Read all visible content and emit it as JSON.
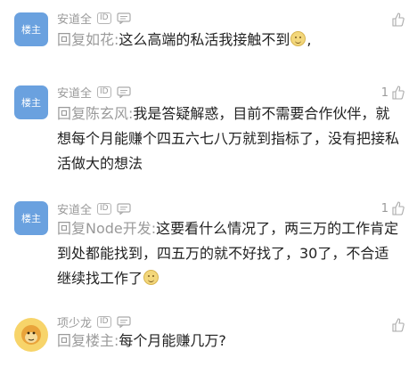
{
  "comments": [
    {
      "avatar_label": "楼主",
      "username": "安道全",
      "id_badge": "ID",
      "likes": "",
      "reply_prefix": "回复如花:",
      "text": "这么高端的私活我接触不到",
      "text_after": ","
    },
    {
      "avatar_label": "楼主",
      "username": "安道全",
      "id_badge": "ID",
      "likes": "1",
      "reply_prefix": "回复陈玄风:",
      "text": "我是答疑解惑，目前不需要合作伙伴，就想每个月能赚个四五六七八万就到指标了，没有把接私活做大的想法",
      "text_after": ""
    },
    {
      "avatar_label": "楼主",
      "username": "安道全",
      "id_badge": "ID",
      "likes": "1",
      "reply_prefix": "回复Node开发:",
      "text": "这要看什么情况了，两三万的工作肯定到处都能找到，四五万的就不好找了，30了，不合适继续找工作了",
      "text_after": ""
    },
    {
      "avatar_label": "",
      "username": "项少龙",
      "id_badge": "ID",
      "likes": "",
      "reply_prefix": "回复楼主:",
      "text": "每个月能赚几万?",
      "text_after": ""
    }
  ]
}
